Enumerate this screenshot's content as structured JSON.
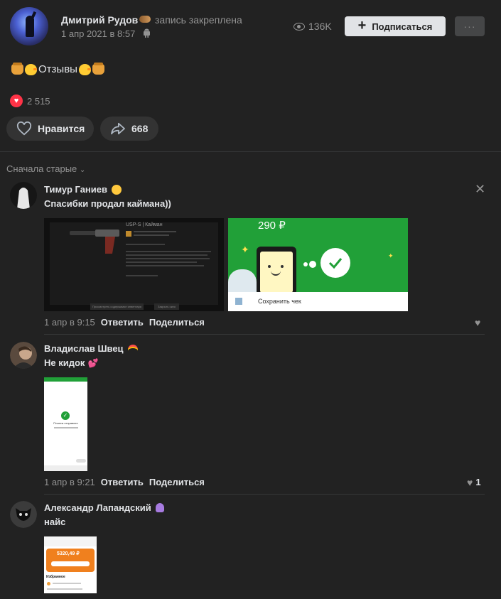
{
  "post": {
    "author": "Дмитрий Рудов",
    "pinned": "запись закреплена",
    "date": "1 апр 2021 в 8:57",
    "views": "136K",
    "subscribe_label": "Подписаться",
    "more_label": "···",
    "text": "Отзывы",
    "likes": "2 515",
    "like_label": "Нравится",
    "shares": "668"
  },
  "sort": {
    "label": "Сначала старые"
  },
  "comments": [
    {
      "author": "Тимур Ганиев",
      "text": "Спасибки продал каймана))",
      "date": "1 апр в 9:15",
      "reply": "Ответить",
      "share": "Поделиться",
      "likes": "",
      "images": {
        "skin_title": "USP-S | Кайман",
        "inspect": "Просмотреть содержимое инвентаря",
        "close": "Закрыть окно",
        "price": "290 ₽",
        "save_check": "Сохранить чек"
      }
    },
    {
      "author": "Владислав Швец",
      "text": "Не кидок",
      "date": "1 апр в 9:21",
      "reply": "Ответить",
      "share": "Поделиться",
      "likes": "1",
      "images": {
        "status": "Платеж отправлен"
      }
    },
    {
      "author": "Александр Лапандский",
      "text": "найс",
      "images": {
        "amount": "5320,49 ₽",
        "favorites": "Избранное"
      }
    }
  ],
  "colors": {
    "accent_green": "#21a038",
    "like_red": "#ff3347",
    "bg": "#222222"
  }
}
